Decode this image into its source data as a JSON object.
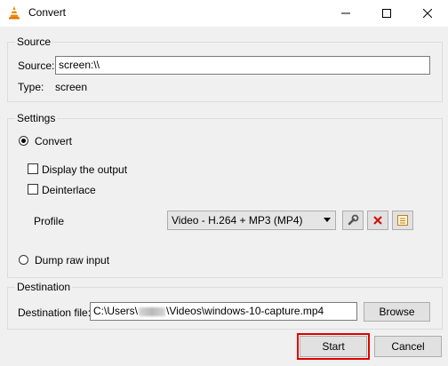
{
  "window": {
    "title": "Convert"
  },
  "source": {
    "group_label": "Source",
    "source_label": "Source:",
    "source_value": "screen:\\\\",
    "type_label": "Type:",
    "type_value": "screen"
  },
  "settings": {
    "group_label": "Settings",
    "convert_label": "Convert",
    "convert_checked": true,
    "display_output_label": "Display the output",
    "deinterlace_label": "Deinterlace",
    "profile_label": "Profile",
    "profile_value": "Video - H.264 + MP3 (MP4)",
    "dump_raw_label": "Dump raw input"
  },
  "destination": {
    "group_label": "Destination",
    "file_label": "Destination file:",
    "file_prefix": "C:\\Users\\",
    "file_suffix": "\\Videos\\windows-10-capture.mp4",
    "browse_label": "Browse"
  },
  "buttons": {
    "start_label": "Start",
    "cancel_label": "Cancel"
  },
  "colors": {
    "highlight": "#e00000",
    "vlc_orange": "#f08a00",
    "delete_red": "#d01010"
  },
  "icons": [
    "vlc-cone-icon",
    "minimize-icon",
    "maximize-icon",
    "close-icon",
    "wrench-icon",
    "delete-icon",
    "new-profile-icon"
  ]
}
